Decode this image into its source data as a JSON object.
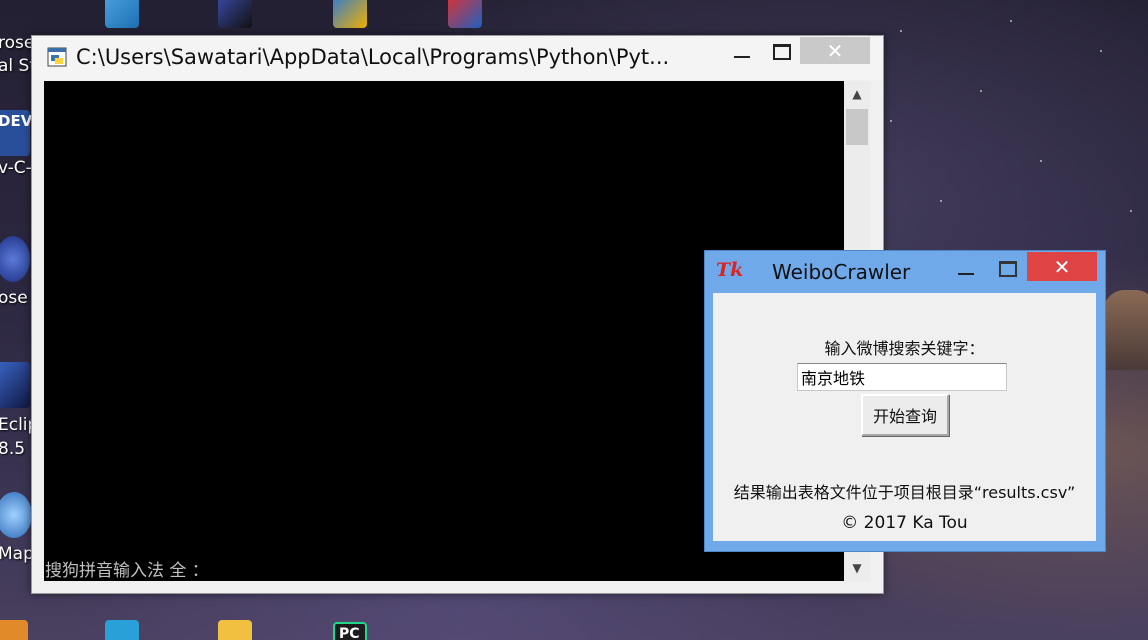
{
  "desktop": {
    "icon_labels": {
      "top_left_1": "rose",
      "top_left_2": "al St",
      "dev": "DEV",
      "dev_label": "v-C-",
      "rose_label": "ose I",
      "eclipse_1": "Eclip",
      "eclipse_2": "8.5",
      "maps": "Map",
      "pycharm": "PC"
    }
  },
  "console": {
    "title": "C:\\Users\\Sawatari\\AppData\\Local\\Programs\\Python\\Pyt...",
    "ime_status": "搜狗拼音输入法 全 ：",
    "minimize": "—",
    "close": "✕",
    "scroll_up": "▲",
    "scroll_down": "▼"
  },
  "tk": {
    "icon_text": "Tk",
    "title": "WeiboCrawler",
    "close": "✕",
    "prompt": "输入微博搜索关键字：",
    "entry_value": "南京地铁",
    "search_button": "开始查询",
    "note": "结果输出表格文件位于项目根目录“results.csv”",
    "copyright": "© 2017 Ka Tou"
  }
}
